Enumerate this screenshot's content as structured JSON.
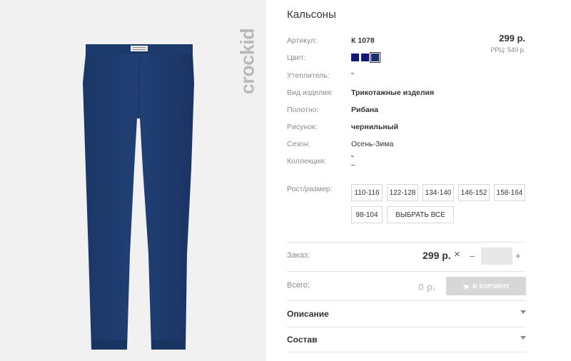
{
  "product": {
    "title": "Кальсоны",
    "brand": "crockid",
    "image_alt": "pants-image"
  },
  "specs": {
    "article": {
      "label": "Артикул:",
      "value": "К 1078"
    },
    "color": {
      "label": "Цвет:"
    },
    "insulation": {
      "label": "Утеплитель:",
      "value": "\""
    },
    "type": {
      "label": "Вид изделия:",
      "value": "Трикотажные изделия"
    },
    "fabric": {
      "label": "Полотно:",
      "value": "Рибана"
    },
    "pattern": {
      "label": "Рисунок:",
      "value": "чернильный"
    },
    "season": {
      "label": "Сезон:",
      "value": "Осень-Зима"
    },
    "collection": {
      "label": "Коллекция:",
      "value": "\"\n–"
    }
  },
  "pricing": {
    "price": "299 р.",
    "rrp": "РРЦ: 549 р."
  },
  "colors": [
    "#14177a",
    "#14177a",
    "#1d2f70"
  ],
  "sizes": {
    "label": "Рост/размер:",
    "options": [
      "110-116",
      "122-128",
      "134-140",
      "146-152",
      "158-164",
      "98-104"
    ],
    "select_all": "ВЫБРАТЬ ВСЕ"
  },
  "order": {
    "label": "Заказ:",
    "price": "299 р.",
    "times": "×",
    "minus": "–",
    "plus": "+",
    "qty": ""
  },
  "total": {
    "label": "Всего:",
    "value": "0 р.",
    "cart_button": "В КОРЗИНУ"
  },
  "accordions": {
    "description": "Описание",
    "composition": "Состав"
  }
}
